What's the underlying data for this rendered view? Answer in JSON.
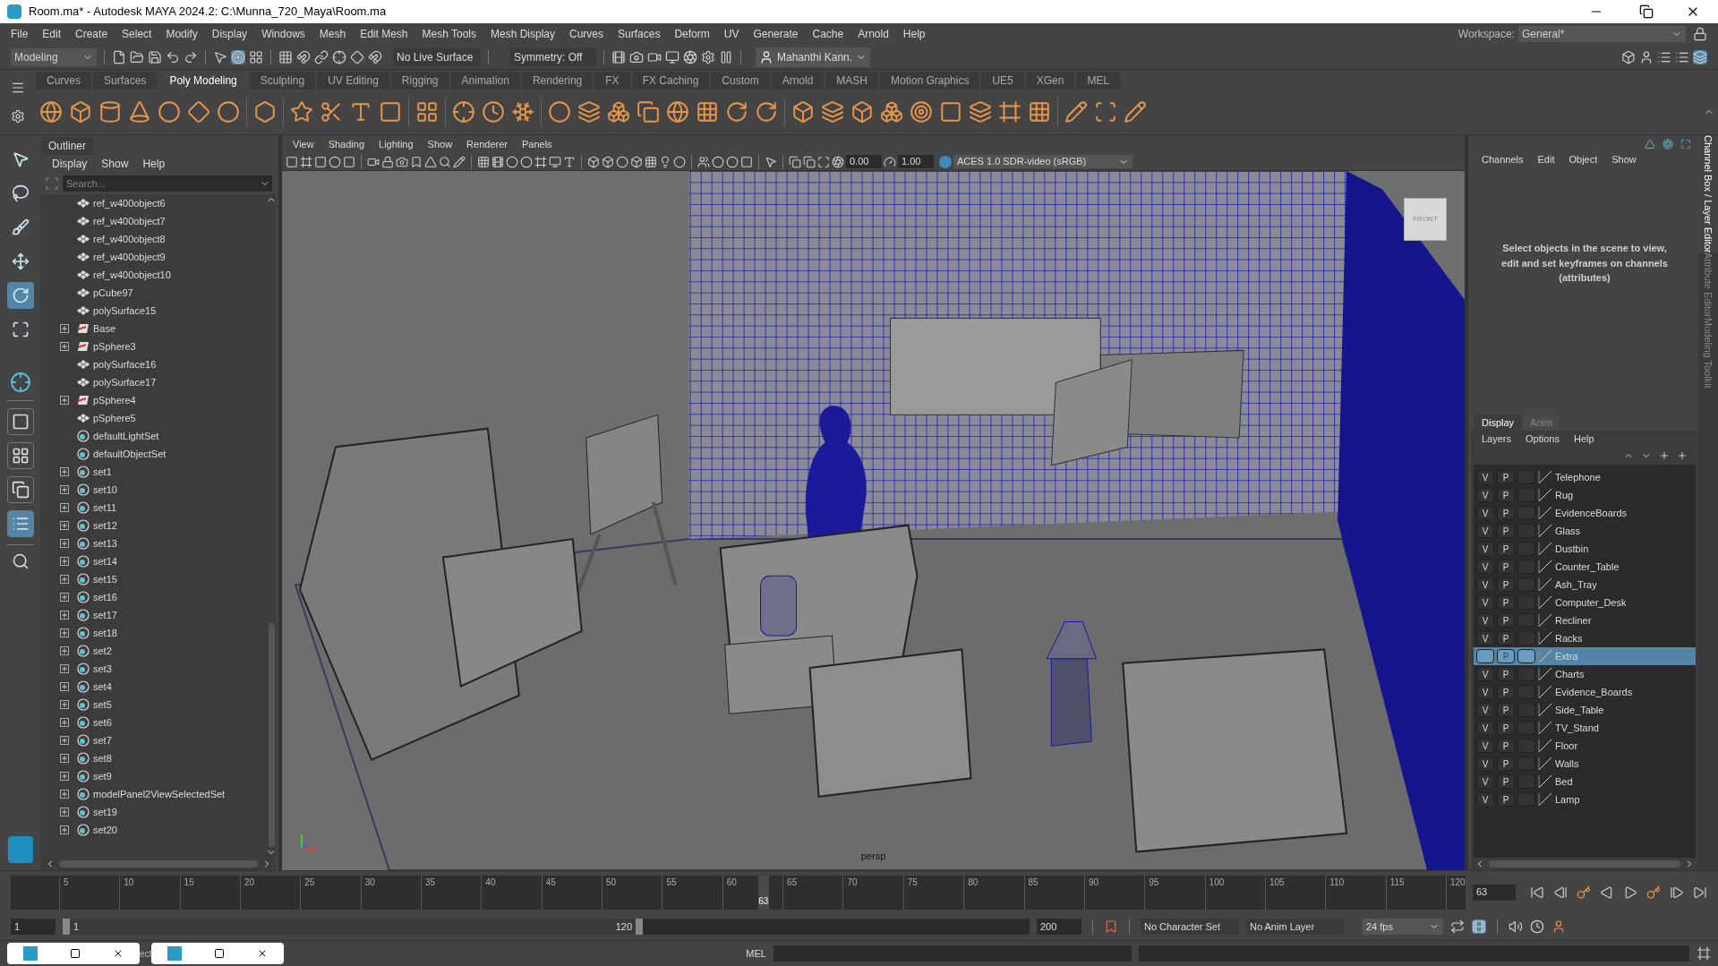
{
  "window": {
    "title": "Room.ma* - Autodesk MAYA 2024.2: C:\\Munna_720_Maya\\Room.ma"
  },
  "menu": [
    "File",
    "Edit",
    "Create",
    "Select",
    "Modify",
    "Display",
    "Windows",
    "Mesh",
    "Edit Mesh",
    "Mesh Tools",
    "Mesh Display",
    "Curves",
    "Surfaces",
    "Deform",
    "UV",
    "Generate",
    "Cache",
    "Arnold",
    "Help"
  ],
  "workspace": {
    "label": "Workspace:",
    "value": "General*"
  },
  "toolbar": {
    "mode": "Modeling",
    "live_surface": "No Live Surface",
    "symmetry": "Symmetry: Off",
    "user": "Mahanthi Kann."
  },
  "shelf_tabs": [
    {
      "label": "Curves",
      "selected": false
    },
    {
      "label": "Surfaces",
      "selected": false
    },
    {
      "label": "Poly Modeling",
      "selected": true
    },
    {
      "label": "Sculpting",
      "selected": false
    },
    {
      "label": "UV Editing",
      "selected": false
    },
    {
      "label": "Rigging",
      "selected": false
    },
    {
      "label": "Animation",
      "selected": false
    },
    {
      "label": "Rendering",
      "selected": false
    },
    {
      "label": "FX",
      "selected": false
    },
    {
      "label": "FX Caching",
      "selected": false
    },
    {
      "label": "Custom",
      "selected": false
    },
    {
      "label": "Arnold",
      "selected": false
    },
    {
      "label": "MASH",
      "selected": false
    },
    {
      "label": "Motion Graphics",
      "selected": false
    },
    {
      "label": "UE5",
      "selected": false
    },
    {
      "label": "XGen",
      "selected": false
    },
    {
      "label": "MEL",
      "selected": false
    }
  ],
  "toolbox": {
    "tools": [
      {
        "selected": false
      },
      {
        "selected": false
      },
      {
        "selected": false
      },
      {
        "selected": false
      },
      {
        "selected": true
      },
      {
        "selected": false
      }
    ],
    "layouts": [
      {
        "selected": false
      },
      {
        "selected": false
      },
      {
        "selected": false
      },
      {
        "selected": true
      }
    ]
  },
  "outliner": {
    "tab": "Outliner",
    "menu": [
      "Display",
      "Show",
      "Help"
    ],
    "search": {
      "placeholder": "Search..."
    },
    "items": [
      {
        "name": "ref_w400object6",
        "kind": "mesh",
        "expandable": false
      },
      {
        "name": "ref_w400object7",
        "kind": "mesh",
        "expandable": false
      },
      {
        "name": "ref_w400object8",
        "kind": "mesh",
        "expandable": false
      },
      {
        "name": "ref_w400object9",
        "kind": "mesh",
        "expandable": false
      },
      {
        "name": "ref_w400object10",
        "kind": "mesh",
        "expandable": false
      },
      {
        "name": "pCube97",
        "kind": "mesh",
        "expandable": false
      },
      {
        "name": "polySurface15",
        "kind": "mesh",
        "expandable": false
      },
      {
        "name": "Base",
        "kind": "group",
        "expandable": true
      },
      {
        "name": "pSphere3",
        "kind": "group",
        "expandable": true
      },
      {
        "name": "polySurface16",
        "kind": "mesh",
        "expandable": false
      },
      {
        "name": "polySurface17",
        "kind": "mesh",
        "expandable": false
      },
      {
        "name": "pSphere4",
        "kind": "group",
        "expandable": true
      },
      {
        "name": "pSphere5",
        "kind": "mesh",
        "expandable": false
      },
      {
        "name": "defaultLightSet",
        "kind": "set",
        "expandable": false
      },
      {
        "name": "defaultObjectSet",
        "kind": "set",
        "expandable": false
      },
      {
        "name": "set1",
        "kind": "set",
        "expandable": true
      },
      {
        "name": "set10",
        "kind": "set",
        "expandable": true
      },
      {
        "name": "set11",
        "kind": "set",
        "expandable": true
      },
      {
        "name": "set12",
        "kind": "set",
        "expandable": true
      },
      {
        "name": "set13",
        "kind": "set",
        "expandable": true
      },
      {
        "name": "set14",
        "kind": "set",
        "expandable": true
      },
      {
        "name": "set15",
        "kind": "set",
        "expandable": true
      },
      {
        "name": "set16",
        "kind": "set",
        "expandable": true
      },
      {
        "name": "set17",
        "kind": "set",
        "expandable": true
      },
      {
        "name": "set18",
        "kind": "set",
        "expandable": true
      },
      {
        "name": "set2",
        "kind": "set",
        "expandable": true
      },
      {
        "name": "set3",
        "kind": "set",
        "expandable": true
      },
      {
        "name": "set4",
        "kind": "set",
        "expandable": true
      },
      {
        "name": "set5",
        "kind": "set",
        "expandable": true
      },
      {
        "name": "set6",
        "kind": "set",
        "expandable": true
      },
      {
        "name": "set7",
        "kind": "set",
        "expandable": true
      },
      {
        "name": "set8",
        "kind": "set",
        "expandable": true
      },
      {
        "name": "set9",
        "kind": "set",
        "expandable": true
      },
      {
        "name": "modelPanel2ViewSelectedSet",
        "kind": "set",
        "expandable": true
      },
      {
        "name": "set19",
        "kind": "set",
        "expandable": true
      },
      {
        "name": "set20",
        "kind": "set",
        "expandable": true
      }
    ]
  },
  "viewport": {
    "menu": [
      "View",
      "Shading",
      "Lighting",
      "Show",
      "Renderer",
      "Panels"
    ],
    "exposure": "0.00",
    "gamma": "1.00",
    "color_space": "ACES 1.0 SDR-video (sRGB)",
    "view_cube": "FRONT",
    "camera": "persp"
  },
  "channel_box": {
    "menu": [
      "Channels",
      "Edit",
      "Object",
      "Show"
    ],
    "message": "Select objects in the scene to view, edit and set keyframes on channels (attributes)"
  },
  "side_tabs": [
    {
      "label": "Channel Box / Layer Editor",
      "selected": true
    },
    {
      "label": "Attribute Editor",
      "selected": false
    },
    {
      "label": "Modeling Toolkit",
      "selected": false
    }
  ],
  "layer_editor": {
    "tabs": [
      {
        "label": "Display",
        "selected": true
      },
      {
        "label": "Anim",
        "selected": false
      }
    ],
    "menu": [
      "Layers",
      "Options",
      "Help"
    ],
    "layers": [
      {
        "name": "Telephone",
        "v": "V",
        "p": "P",
        "selected": false
      },
      {
        "name": "Rug",
        "v": "V",
        "p": "P",
        "selected": false
      },
      {
        "name": "EvidenceBoards",
        "v": "V",
        "p": "P",
        "selected": false
      },
      {
        "name": "Glass",
        "v": "V",
        "p": "P",
        "selected": false
      },
      {
        "name": "Dustbin",
        "v": "V",
        "p": "P",
        "selected": false
      },
      {
        "name": "Counter_Table",
        "v": "V",
        "p": "P",
        "selected": false
      },
      {
        "name": "Ash_Tray",
        "v": "V",
        "p": "P",
        "selected": false
      },
      {
        "name": "Computer_Desk",
        "v": "V",
        "p": "P",
        "selected": false
      },
      {
        "name": "Recliner",
        "v": "V",
        "p": "P",
        "selected": false
      },
      {
        "name": "Racks",
        "v": "V",
        "p": "P",
        "selected": false
      },
      {
        "name": "Extra",
        "p": "P",
        "selected": true
      },
      {
        "name": "Charts",
        "v": "V",
        "p": "P",
        "selected": false
      },
      {
        "name": "Evidence_Boards",
        "v": "V",
        "p": "P",
        "selected": false
      },
      {
        "name": "Side_Table",
        "v": "V",
        "p": "P",
        "selected": false
      },
      {
        "name": "TV_Stand",
        "v": "V",
        "p": "P",
        "selected": false
      },
      {
        "name": "Floor",
        "v": "V",
        "p": "P",
        "selected": false
      },
      {
        "name": "Walls",
        "v": "V",
        "p": "P",
        "selected": false
      },
      {
        "name": "Bed",
        "v": "V",
        "p": "P",
        "selected": false
      },
      {
        "name": "Lamp",
        "v": "V",
        "p": "P",
        "selected": false
      }
    ]
  },
  "timeline": {
    "ticks": [
      "5",
      "10",
      "15",
      "20",
      "25",
      "30",
      "35",
      "40",
      "45",
      "50",
      "55",
      "60",
      "65",
      "70",
      "75",
      "80",
      "85",
      "90",
      "95",
      "100",
      "105",
      "110",
      "115",
      "120"
    ],
    "current": "63",
    "level": 0.521,
    "current_field": "63"
  },
  "range": {
    "start": "1",
    "range_start": "1",
    "range_end": "120",
    "level": 0.6,
    "end": "200",
    "character_set": "No Character Set",
    "anim_layer": "No Anim Layer",
    "fps": "24 fps"
  },
  "command_line": {
    "label": "MEL"
  },
  "taskbar": {
    "partial_text": "ect"
  }
}
